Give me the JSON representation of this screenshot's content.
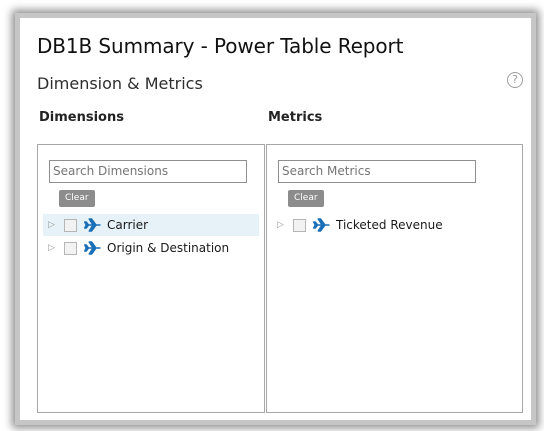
{
  "report_title": "DB1B Summary - Power Table Report",
  "section_title": "Dimension & Metrics",
  "help_icon_glyph": "?",
  "dimensions": {
    "heading": "Dimensions",
    "search_placeholder": "Search Dimensions",
    "clear_label": "Clear",
    "items": [
      {
        "label": "Carrier",
        "icon": "airplane-icon",
        "selected": true
      },
      {
        "label": "Origin & Destination",
        "icon": "airplane-icon",
        "selected": false
      }
    ]
  },
  "metrics": {
    "heading": "Metrics",
    "search_placeholder": "Search Metrics",
    "clear_label": "Clear",
    "items": [
      {
        "label": "Ticketed Revenue",
        "icon": "airplane-icon",
        "selected": false
      }
    ]
  },
  "colors": {
    "icon_blue": "#1a6fb7",
    "selected_row": "#e6f2f8",
    "clear_button": "#8c8c8c"
  }
}
